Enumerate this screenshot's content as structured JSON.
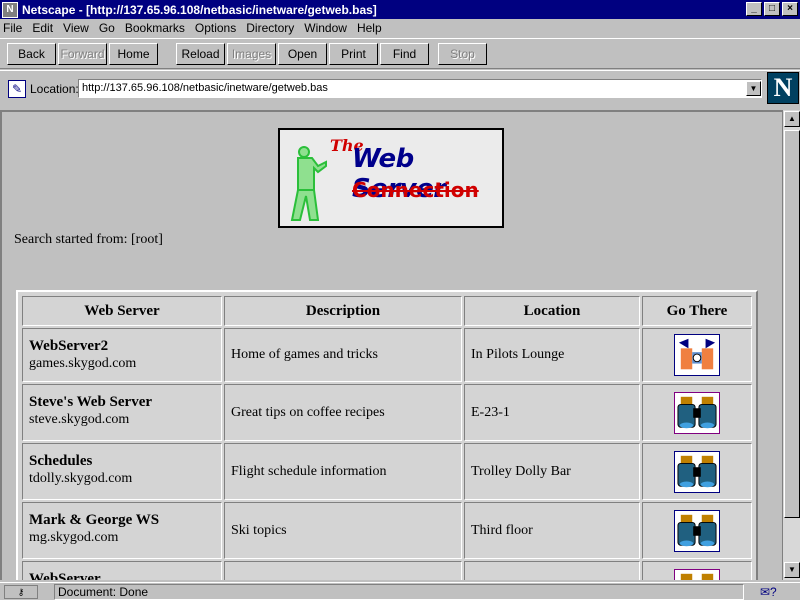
{
  "window": {
    "title": "Netscape - [http://137.65.96.108/netbasic/inetware/getweb.bas]",
    "controls": [
      "_",
      "□",
      "×"
    ]
  },
  "menu": [
    "File",
    "Edit",
    "View",
    "Go",
    "Bookmarks",
    "Options",
    "Directory",
    "Window",
    "Help"
  ],
  "toolbar": {
    "back": "Back",
    "forward": "Forward",
    "home": "Home",
    "reload": "Reload",
    "images": "Images",
    "open": "Open",
    "print": "Print",
    "find": "Find",
    "stop": "Stop"
  },
  "location": {
    "label": "Location:",
    "url": "http://137.65.96.108/netbasic/inetware/getweb.bas",
    "logo": "N"
  },
  "banner": {
    "the": "The",
    "line1": "Web Server",
    "line2": "Connection"
  },
  "search_note": "Search started from: [root]",
  "table": {
    "headers": [
      "Web Server",
      "Description",
      "Location",
      "Go There"
    ],
    "rows": [
      {
        "name": "WebServer2",
        "host": "games.skygod.com",
        "description": "Home of games and tricks",
        "location": "In Pilots Lounge",
        "icon": "games-icon"
      },
      {
        "name": "Steve's Web Server",
        "host": "steve.skygod.com",
        "description": "Great tips on coffee recipes",
        "location": "E-23-1",
        "icon": "binoculars-icon"
      },
      {
        "name": "Schedules",
        "host": "tdolly.skygod.com",
        "description": "Flight schedule information",
        "location": "Trolley Dolly Bar",
        "icon": "binoculars-icon"
      },
      {
        "name": "Mark & George WS",
        "host": "mg.skygod.com",
        "description": "Ski topics",
        "location": "Third floor",
        "icon": "binoculars-icon"
      },
      {
        "name": "WebServer",
        "host": "",
        "description": "",
        "location": "",
        "icon": "binoculars-icon"
      }
    ]
  },
  "status": {
    "text": "Document: Done"
  }
}
